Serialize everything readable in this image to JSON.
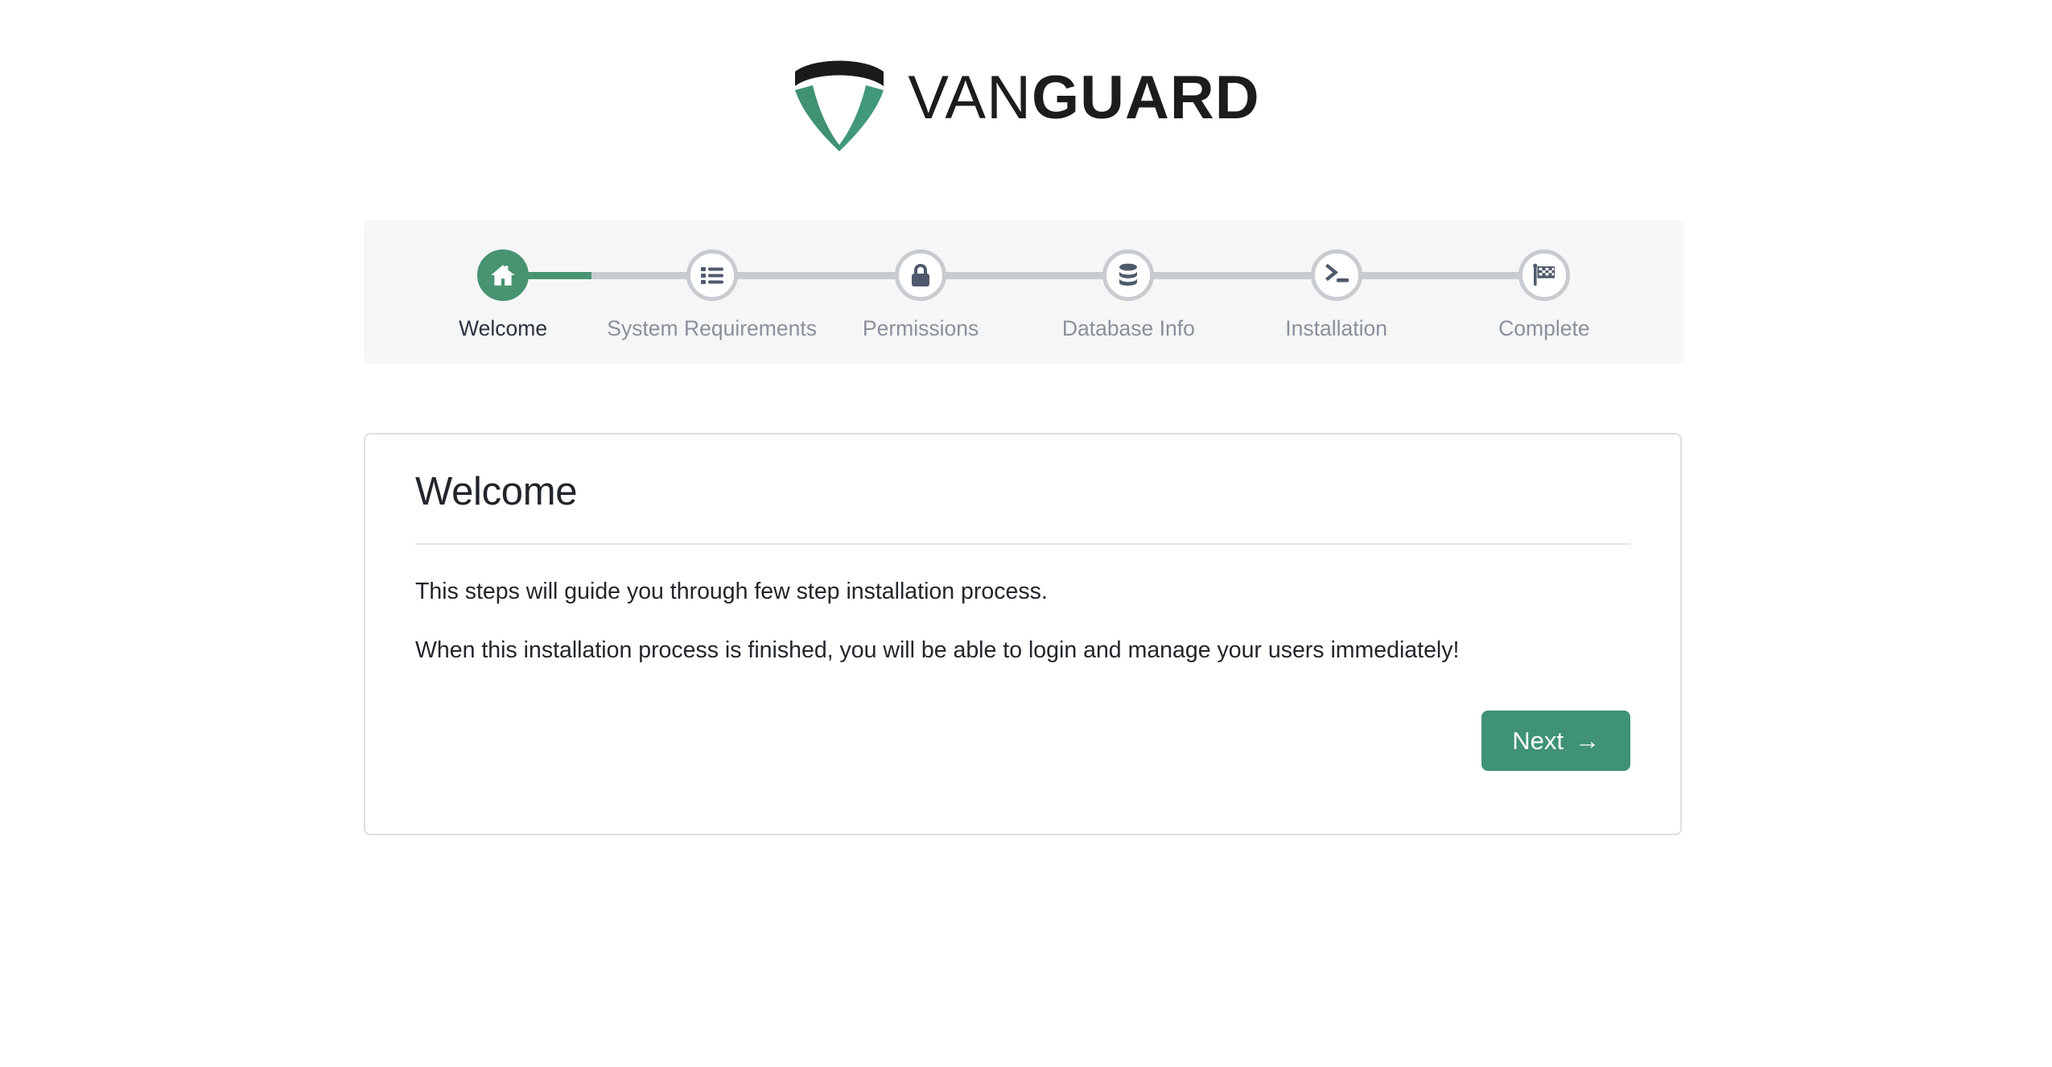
{
  "brand": {
    "name_light": "VAN",
    "name_bold": "GUARD",
    "logo_icon": "shield-icon",
    "shield_top_color": "#1a1a1a",
    "shield_body_color": "#3f9272"
  },
  "stepper": {
    "active_index": 0,
    "accent_color": "#489372",
    "inactive_color": "#c8cbd0",
    "steps": [
      {
        "label": "Welcome",
        "icon": "home-icon",
        "state": "active"
      },
      {
        "label": "System Requirements",
        "icon": "list-icon",
        "state": "inactive"
      },
      {
        "label": "Permissions",
        "icon": "lock-icon",
        "state": "inactive"
      },
      {
        "label": "Database Info",
        "icon": "database-icon",
        "state": "inactive"
      },
      {
        "label": "Installation",
        "icon": "terminal-icon",
        "state": "inactive"
      },
      {
        "label": "Complete",
        "icon": "checkered-flag-icon",
        "state": "inactive"
      }
    ]
  },
  "card": {
    "title": "Welcome",
    "paragraphs": [
      "This steps will guide you through few step installation process.",
      "When this installation process is finished, you will be able to login and manage your users immediately!"
    ],
    "next_label": "Next",
    "next_arrow": "→",
    "next_color": "#3f9273"
  }
}
